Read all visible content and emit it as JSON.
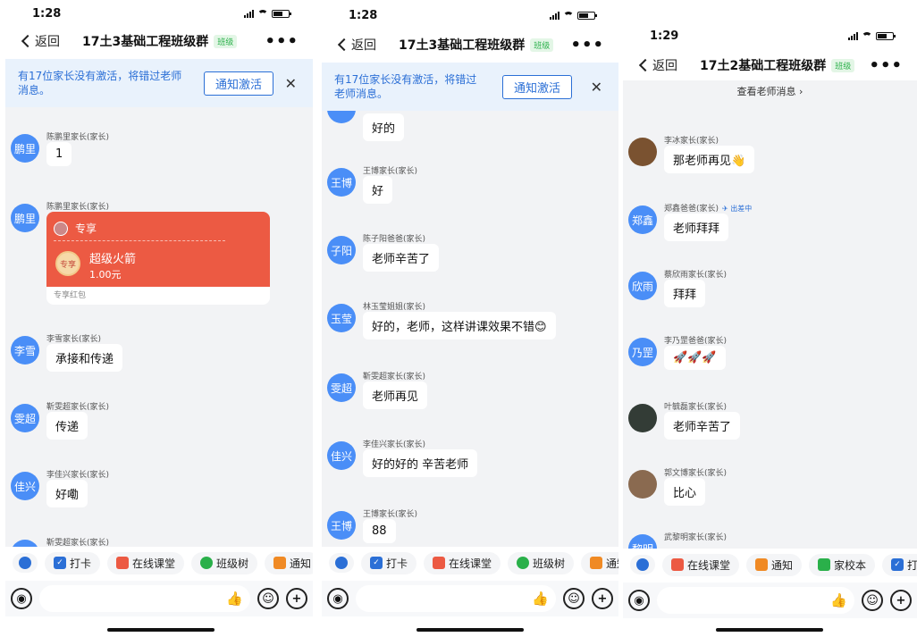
{
  "panels": [
    {
      "time": "1:28",
      "back": "返回",
      "title": "17土3基础工程班级群",
      "tag": "班级",
      "more": "•••",
      "banner": {
        "text": "有17位家长没有激活，将错过老师消息。",
        "button": "通知激活",
        "close": "✕"
      },
      "messages": [
        {
          "avatar": "鹏里",
          "sender": "陈鹏里家长(家长)",
          "text": "1"
        },
        {
          "avatar": "鹏里",
          "sender": "陈鹏里家长(家长)",
          "redpacket": {
            "head": "专享",
            "name": "超级火箭",
            "amount": "1.00元",
            "coin": "专享",
            "footer": "专享红包"
          }
        },
        {
          "avatar": "李雪",
          "sender": "李雪家长(家长)",
          "text": "承接和传递"
        },
        {
          "avatar": "雯超",
          "sender": "靳雯超家长(家长)",
          "text": "传递"
        },
        {
          "avatar": "佳兴",
          "sender": "李佳兴家长(家长)",
          "text": "好嘞"
        },
        {
          "avatar": "",
          "sender": "靳雯超家长(家长)",
          "text": ""
        }
      ],
      "toolbar": [
        "打卡",
        "在线课堂",
        "班级树",
        "通知"
      ]
    },
    {
      "time": "1:28",
      "back": "返回",
      "title": "17土3基础工程班级群",
      "tag": "班级",
      "more": "•••",
      "banner": {
        "text": "有17位家长没有激活，将错过老师消息。",
        "button": "通知激活",
        "close": "✕"
      },
      "messages": [
        {
          "avatar": "",
          "sender": "",
          "text": "好的"
        },
        {
          "avatar": "王博",
          "sender": "王博家长(家长)",
          "text": "好"
        },
        {
          "avatar": "子阳",
          "sender": "陈子阳爸爸(家长)",
          "text": "老师辛苦了"
        },
        {
          "avatar": "玉莹",
          "sender": "林玉莹姐姐(家长)",
          "text": "好的，老师，这样讲课效果不错😊"
        },
        {
          "avatar": "雯超",
          "sender": "靳雯超家长(家长)",
          "text": "老师再见"
        },
        {
          "avatar": "佳兴",
          "sender": "李佳兴家长(家长)",
          "text": "好的好的 辛苦老师"
        },
        {
          "avatar": "王博",
          "sender": "王博家长(家长)",
          "text": "88"
        }
      ],
      "toolbar": [
        "打卡",
        "在线课堂",
        "班级树",
        "通知"
      ]
    },
    {
      "time": "1:29",
      "back": "返回",
      "title": "17土2基础工程班级群",
      "tag": "班级",
      "more": "•••",
      "view_teacher": "查看老师消息 ›",
      "messages": [
        {
          "avatar": "",
          "sender": "李冰家长(家长)",
          "text": "那老师再见👋",
          "photo": "photo1"
        },
        {
          "avatar": "郑鑫",
          "sender": "郑鑫爸爸(家长)",
          "flight": "✈ 出差中",
          "text": "老师拜拜"
        },
        {
          "avatar": "欣雨",
          "sender": "蔡欣雨家长(家长)",
          "text": "拜拜"
        },
        {
          "avatar": "乃罡",
          "sender": "李乃罡爸爸(家长)",
          "text": "🚀🚀🚀"
        },
        {
          "avatar": "",
          "sender": "叶毓磊家长(家长)",
          "text": "老师辛苦了",
          "photo": "photo2"
        },
        {
          "avatar": "",
          "sender": "郭文博家长(家长)",
          "text": "比心",
          "photo": "photo3"
        },
        {
          "avatar": "黎明",
          "sender": "武黎明家长(家长)",
          "text": ""
        }
      ],
      "toolbar": [
        "在线课堂",
        "通知",
        "家校本",
        "打卡"
      ]
    }
  ],
  "colors": {
    "accent": "#2b6fd6",
    "avatar": "#4a8ef7",
    "redpacket": "#ec5a43",
    "chat_bg": "#f2f3f5"
  },
  "icons": {
    "voice": "mic-icon",
    "emoji": "emoji-icon",
    "plus": "plus-icon",
    "like": "thumb-icon"
  }
}
